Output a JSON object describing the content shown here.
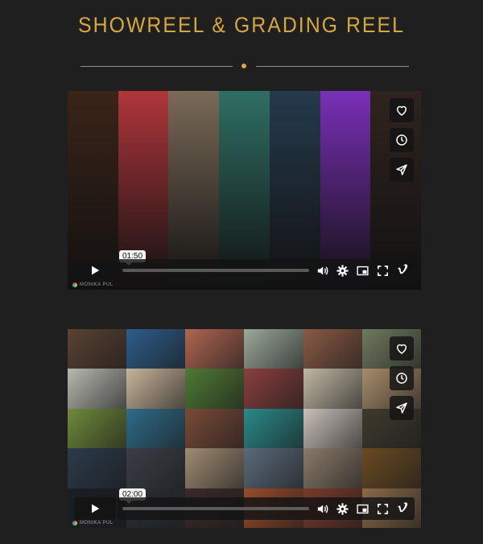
{
  "page": {
    "title": "SHOWREEL & GRADING REEL",
    "accent_color": "#d7a842",
    "background_color": "#1f1f1f"
  },
  "players": [
    {
      "name": "showreel",
      "time_tooltip": "01:50",
      "progress_fraction": 0.0,
      "watermark": "MONIKA PUL",
      "side_actions": [
        "like-icon",
        "watch-later-icon",
        "share-icon"
      ],
      "control_icons": [
        "volume-icon",
        "settings-icon",
        "picture-in-picture-icon",
        "fullscreen-icon",
        "vimeo-icon"
      ],
      "strip_colors": [
        "#3a2418",
        "#b0363b",
        "#7a6a58",
        "#2f6f64",
        "#253a4c",
        "#7a2fb8",
        "#30231f"
      ]
    },
    {
      "name": "grading-reel",
      "time_tooltip": "02:00",
      "progress_fraction": 0.0,
      "watermark": "MONIKA PUL",
      "side_actions": [
        "like-icon",
        "watch-later-icon",
        "share-icon"
      ],
      "control_icons": [
        "volume-icon",
        "settings-icon",
        "picture-in-picture-icon",
        "fullscreen-icon",
        "vimeo-icon"
      ],
      "tile_colors": [
        "#5a4232",
        "#2c5d8a",
        "#b06552",
        "#9aa89a",
        "#8a5a44",
        "#6f7a5e",
        "#b8b8b0",
        "#c8b49a",
        "#4f7a34",
        "#8a3e3e",
        "#c0b8a4",
        "#a88c6a",
        "#6e8a3a",
        "#2f6b8a",
        "#7a4a38",
        "#2a8a8a",
        "#c8c0b8",
        "#3e3a2e",
        "#2b3a4a",
        "#3a3f46",
        "#a08c74",
        "#5a6a7a",
        "#8a7a6a",
        "#6a4a22",
        "#1a1f26",
        "#2a3038",
        "#3a2a2a",
        "#9a4a2a",
        "#7a3a2a",
        "#8a6a4a"
      ]
    }
  ]
}
